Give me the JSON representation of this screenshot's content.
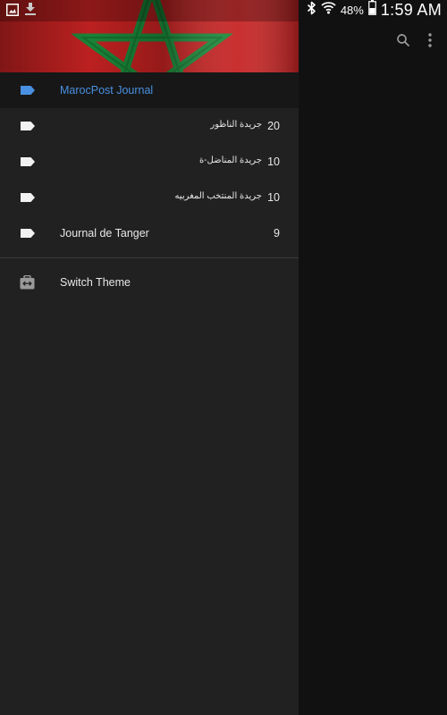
{
  "status_bar": {
    "battery_percent": "48%",
    "time": "1:59 AM",
    "left_icons": [
      "gallery-icon",
      "download-icon"
    ],
    "right_icons": [
      "bluetooth-icon",
      "wifi-icon",
      "battery-icon"
    ]
  },
  "toolbar": {
    "icons": [
      "search-icon",
      "more-vert-icon"
    ]
  },
  "drawer": {
    "header_image": "morocco-flag",
    "items": [
      {
        "label": "MarocPost Journal",
        "count": "",
        "rtl": false,
        "selected": true
      },
      {
        "label": "جريدة الناظور",
        "count": "20",
        "rtl": true,
        "selected": false
      },
      {
        "label": "جريدة المناضل-ة",
        "count": "10",
        "rtl": true,
        "selected": false
      },
      {
        "label": "جريدة المنتخب المغربيه",
        "count": "10",
        "rtl": true,
        "selected": false
      },
      {
        "label": "Journal de Tanger",
        "count": "9",
        "rtl": false,
        "selected": false
      }
    ],
    "switch_theme": {
      "label": "Switch Theme",
      "icon": "switch-theme-icon"
    }
  },
  "colors": {
    "accent": "#4a90e2",
    "drawer_bg": "#212121",
    "selected_bg": "#171717",
    "right_pane_bg": "#111111",
    "flag_red": "#c62222",
    "flag_green": "#1b8a3a"
  }
}
